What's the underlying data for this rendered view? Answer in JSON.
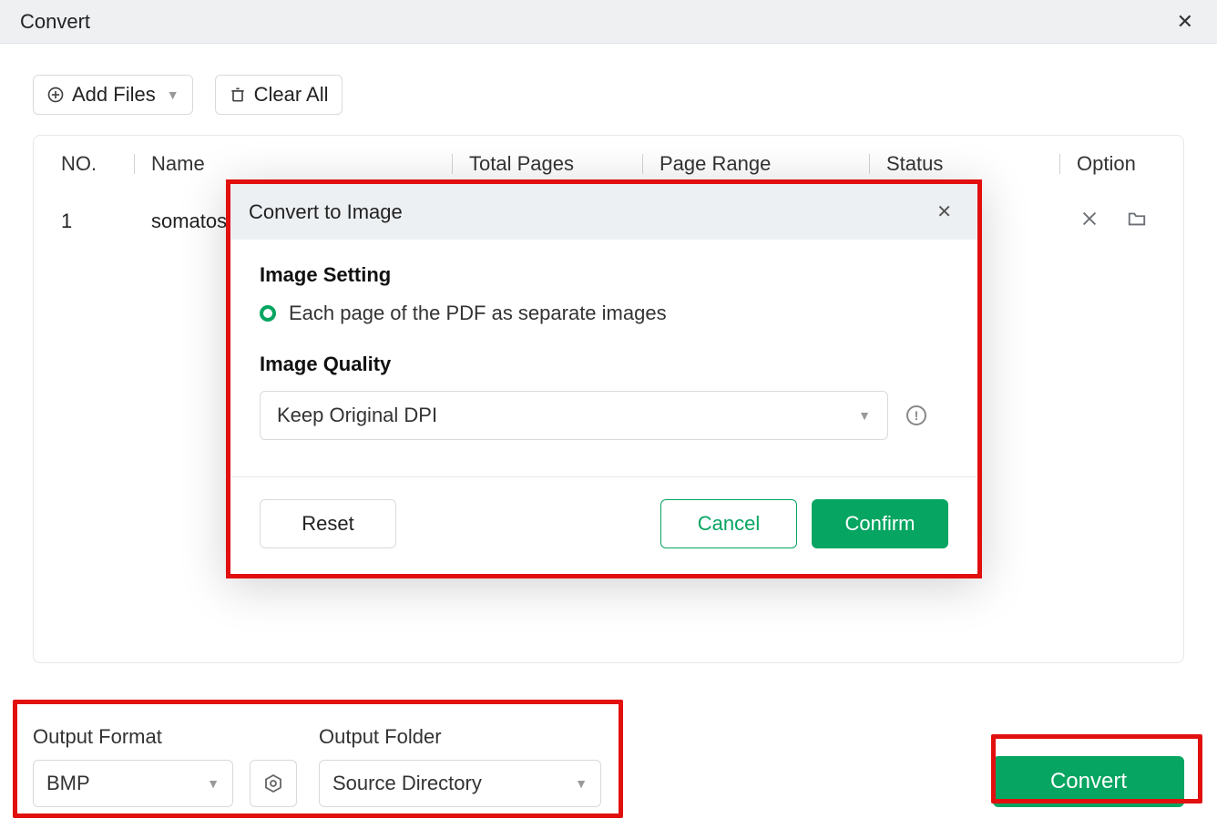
{
  "title": "Convert",
  "toolbar": {
    "add_files": "Add Files",
    "clear_all": "Clear All"
  },
  "columns": {
    "no": "NO.",
    "name": "Name",
    "pages": "Total Pages",
    "range": "Page Range",
    "status": "Status",
    "option": "Option"
  },
  "row": {
    "no": "1",
    "name": "somatose"
  },
  "footer": {
    "format_label": "Output Format",
    "format_value": "BMP",
    "folder_label": "Output Folder",
    "folder_value": "Source Directory",
    "convert": "Convert"
  },
  "modal": {
    "title": "Convert to Image",
    "image_setting": "Image Setting",
    "radio_label": "Each page of the PDF as separate images",
    "image_quality": "Image Quality",
    "quality_value": "Keep Original DPI",
    "reset": "Reset",
    "cancel": "Cancel",
    "confirm": "Confirm"
  }
}
